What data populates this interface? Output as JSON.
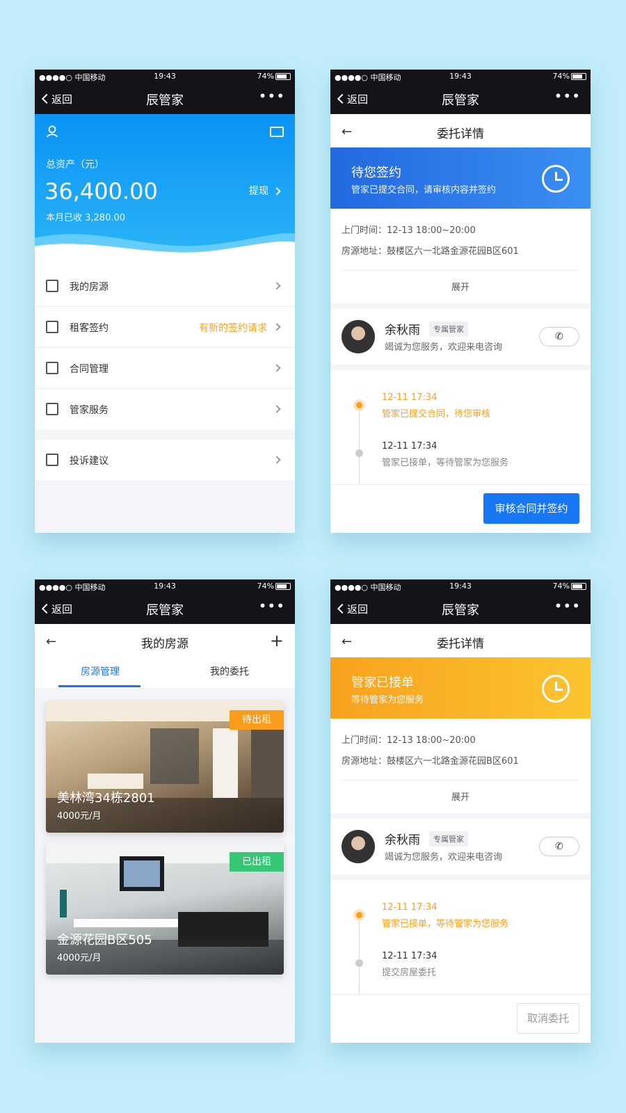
{
  "status_bar": {
    "carrier": "●●●●○ 中国移动",
    "time": "19:43",
    "battery": "74%"
  },
  "nav": {
    "back": "返回",
    "title": "辰管家",
    "more": "•••"
  },
  "wallet": {
    "total_label": "总资产（元）",
    "total_amount": "36,400.00",
    "month_received": "本月已收 3,280.00",
    "withdraw": "提现",
    "menu": [
      {
        "label": "我的房源",
        "extra": ""
      },
      {
        "label": "租客签约",
        "extra": "有新的签约请求"
      },
      {
        "label": "合同管理",
        "extra": ""
      },
      {
        "label": "管家服务",
        "extra": ""
      }
    ],
    "menu2": [
      {
        "label": "投诉建议"
      }
    ]
  },
  "detail_common": {
    "title": "委托详情",
    "visit_time": "上门时间：12-13 18:00~20:00",
    "address": "房源地址：鼓楼区六一北路金源花园B区601",
    "expand": "展开",
    "agent_name": "余秋雨",
    "agent_tag": "专属管家",
    "agent_desc": "竭诚为您服务，欢迎来电咨询",
    "phone_icon": "✆"
  },
  "detail_sign": {
    "banner_title": "待您签约",
    "banner_sub": "管家已提交合同，请审核内容并签约",
    "banner_color": "#2b7df0",
    "timeline": [
      {
        "time": "12-11 17:34",
        "text": "管家已提交合同，待您审核"
      },
      {
        "time": "12-11 17:34",
        "text": "管家已接单，等待管家为您服务"
      }
    ],
    "action": "审核合同并签约"
  },
  "detail_accept": {
    "banner_title": "管家已接单",
    "banner_sub": "等待管家为您服务",
    "banner_color": "#f9b12a",
    "timeline": [
      {
        "time": "12-11 17:34",
        "text": "管家已接单，等待管家为您服务"
      },
      {
        "time": "12-11 17:34",
        "text": "提交房屋委托"
      }
    ],
    "action": "取消委托"
  },
  "houses": {
    "title": "我的房源",
    "tabs": [
      "房源管理",
      "我的委托"
    ],
    "items": [
      {
        "name": "美林湾34栋2801",
        "price": "4000元/月",
        "status": "待出租",
        "status_color": "#f99c1c"
      },
      {
        "name": "金源花园B区505",
        "price": "4000元/月",
        "status": "已出租",
        "status_color": "#37c576"
      }
    ]
  }
}
